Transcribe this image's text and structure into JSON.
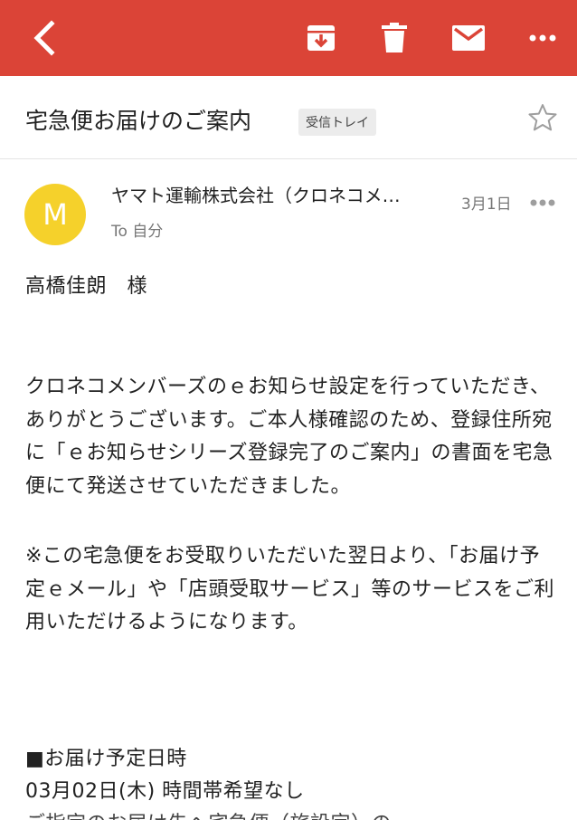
{
  "toolbar": {
    "color": "#db4437",
    "icons": [
      "back-arrow-icon",
      "archive-icon",
      "trash-icon",
      "mail-icon",
      "more-horizontal-icon"
    ]
  },
  "email": {
    "subject": "宅急便お届けのご案内",
    "label": "受信トレイ",
    "sender": {
      "initial": "M",
      "avatar_color": "#f5d12b",
      "name": "ヤマト運輸株式会社（クロネコメ…",
      "recipient": "To 自分",
      "date": "3月1日"
    },
    "body": {
      "greeting": "高橋佳朗　様",
      "paragraph1": "クロネコメンバーズのｅお知らせ設定を行っていただき、ありがとうございます。ご本人様確認のため、登録住所宛に「ｅお知らせシリーズ登録完了のご案内」の書面を宅急便にて発送させていただきました。",
      "notice": "※この宅急便をお受取りいただいた翌日より、「お届け予定ｅメール」や「店頭受取サービス」等のサービスをご利用いただけるようになります。",
      "delivery_heading": "■お届け予定日時",
      "delivery_date": "03月02日(木)  時間帯希望なし",
      "cutoff_line": "ご指定のお届け先へ宅急便（旅設定）の"
    }
  }
}
